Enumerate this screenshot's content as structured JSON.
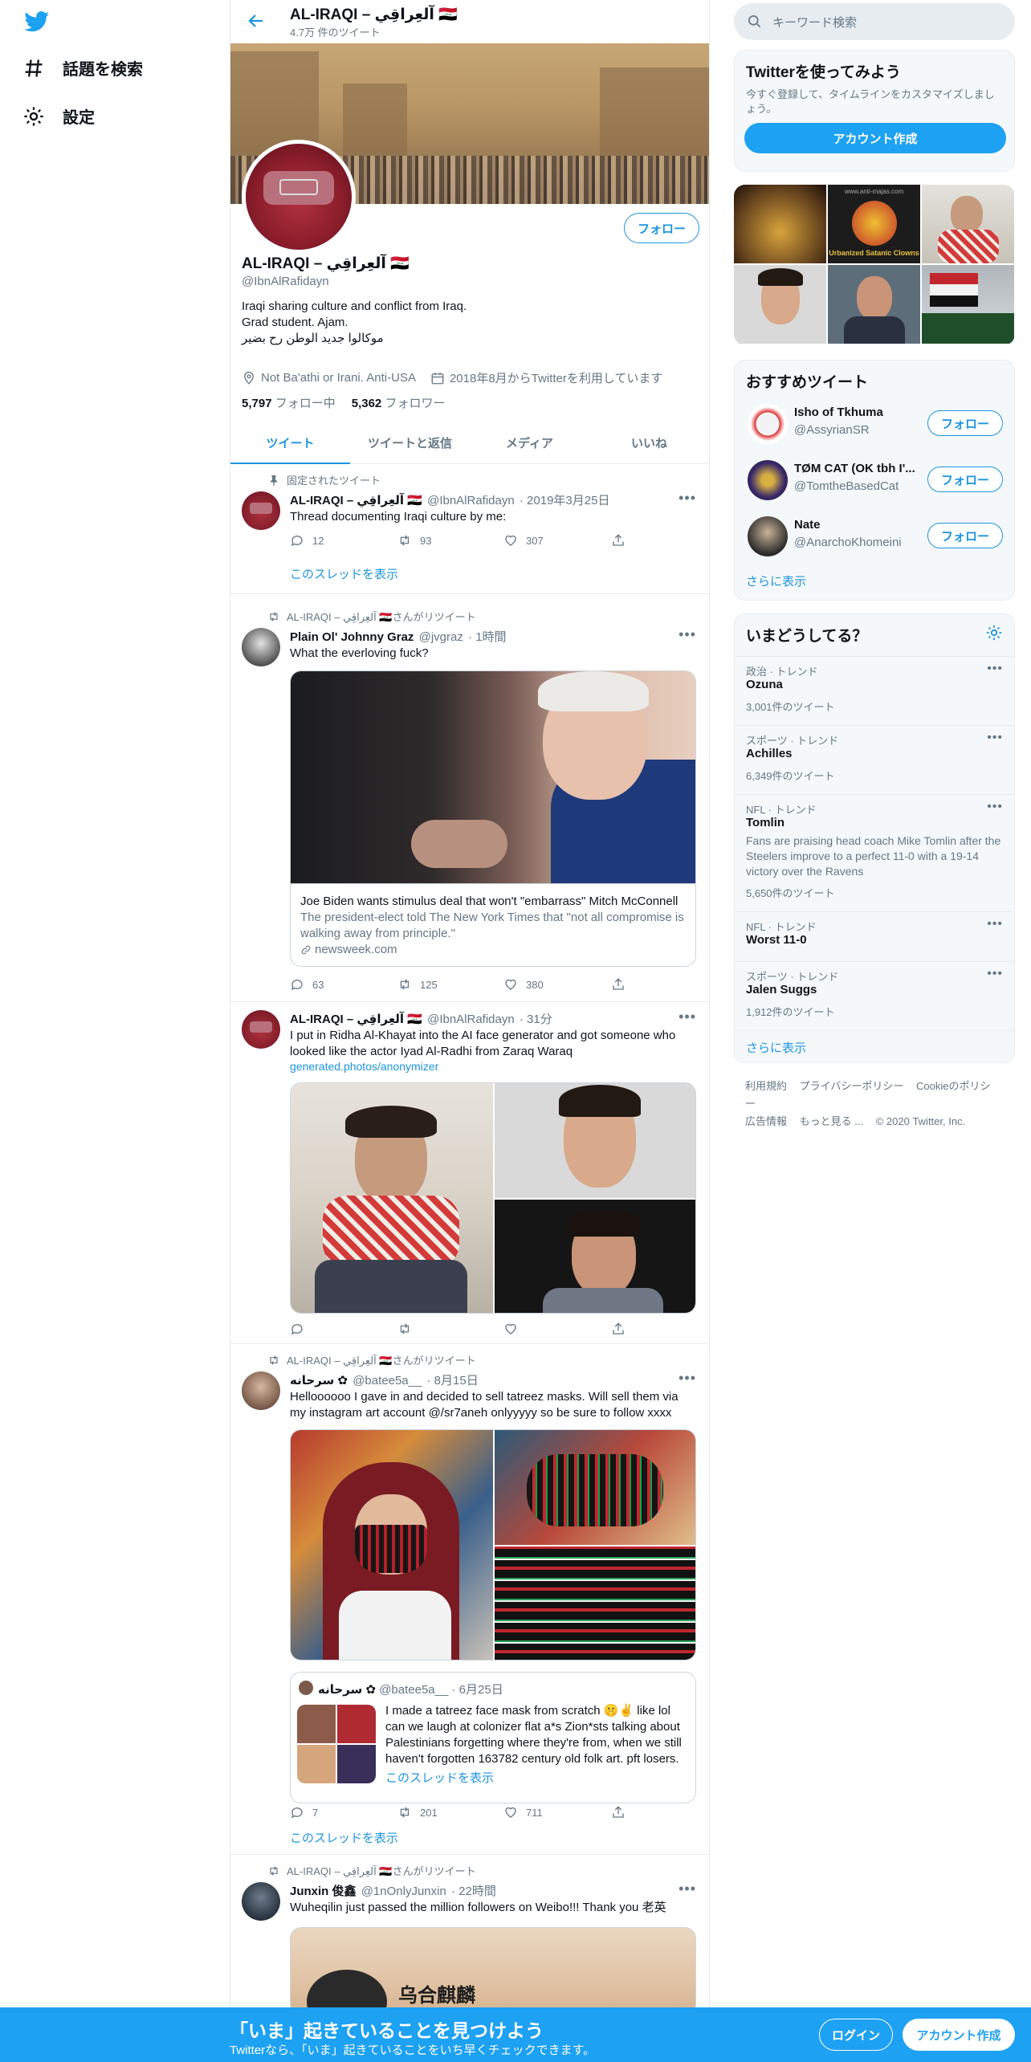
{
  "nav": {
    "explore_label": "話題を検索",
    "settings_label": "設定"
  },
  "header": {
    "name": "AL-IRAQI – آلعِراقِي 🇮🇶",
    "tweet_count": "4.7万 件のツイート"
  },
  "profile": {
    "name": "AL-IRAQI – آلعِراقِي 🇮🇶",
    "handle": "@IbnAlRafidayn",
    "follow_label": "フォロー",
    "bio_line1": "Iraqi sharing culture and conflict from Iraq.",
    "bio_line2": "Grad student. Ajam.",
    "bio_line3": "موﻛﺎﻟﻮا ﺟﺪﻳﺪ اﻟﻮﻃﻦ رح ﺑﻀﻴﺮ",
    "location": "Not Ba'athi or Irani. Anti-USA",
    "joined": "2018年8月からTwitterを利用しています",
    "following_count": "5,797",
    "following_label": "フォロー中",
    "followers_count": "5,362",
    "followers_label": "フォロワー"
  },
  "tabs": [
    "ツイート",
    "ツイートと返信",
    "メディア",
    "いいね"
  ],
  "tweets": [
    {
      "context": "固定されたツイート",
      "name": "AL-IRAQI – آلعِراقِي 🇮🇶",
      "handle": "@IbnAlRafidayn",
      "time": "· 2019年3月25日",
      "text": "Thread documenting Iraqi culture by me:",
      "replies": "12",
      "retweets": "93",
      "likes": "307",
      "thread_link": "このスレッドを表示"
    },
    {
      "context": "AL-IRAQI – آلعِراقِي 🇮🇶さんがリツイート",
      "name": "Plain Ol' Johnny Graz",
      "handle": "@jvgraz",
      "time": "· 1時間",
      "text": "What the everloving fuck?",
      "card_title": "Joe Biden wants stimulus deal that won't \"embarrass\" Mitch McConnell",
      "card_desc": "The president-elect told The New York Times that \"not all compromise is walking away from principle.\"",
      "card_domain": "newsweek.com",
      "replies": "63",
      "retweets": "125",
      "likes": "380"
    },
    {
      "name": "AL-IRAQI – آلعِراقِي 🇮🇶",
      "handle": "@IbnAlRafidayn",
      "time": "· 31分",
      "text": "I put in Ridha Al-Khayat into the AI face generator and got someone who looked like the actor Iyad Al-Radhi from Zaraq Waraq",
      "link": "generated.photos/anonymizer"
    },
    {
      "context": "AL-IRAQI – آلعِراقِي 🇮🇶さんがリツイート",
      "name": "سرحانه ✿",
      "handle": "@batee5a__",
      "time": "· 8月15日",
      "text": "Helloooooo I gave in and decided to sell tatreez masks. Will sell them via my instagram art account @/sr7aneh onlyyyyy so be sure to follow xxxx",
      "quote_name": "سرحانه ✿",
      "quote_handle": "@batee5a__",
      "quote_time": "· 6月25日",
      "quote_text": "I made a tatreez face mask from scratch 🤫✌️ like lol can we laugh at colonizer flat a*s Zion*sts talking about Palestinians forgetting where they're from, when we still haven't forgotten 163782 century old folk art. pft losers.",
      "quote_thread": "このスレッドを表示",
      "replies": "7",
      "retweets": "201",
      "likes": "711",
      "thread_link": "このスレッドを表示"
    },
    {
      "context": "AL-IRAQI – آلعِراقِي 🇮🇶さんがリツイート",
      "name": "Junxin 俊鑫",
      "handle": "@1nOnlyJunxin",
      "time": "· 22時間",
      "text": "Wuheqilin just passed the million followers on Weibo!!! Thank you 老英",
      "image_text": "乌合麒麟"
    }
  ],
  "right": {
    "search_placeholder": "キーワード検索",
    "signup_title": "Twitterを使ってみよう",
    "signup_desc": "今すぐ登録して、タイムラインをカスタマイズしましょう。",
    "signup_button": "アカウント作成",
    "photo_caption": "Urbanized Satanic Clowns",
    "photo_url": "www.anti-majas.com",
    "rec_title": "おすすめツイート",
    "recommendations": [
      {
        "name": "Isho of Tkhuma",
        "handle": "@AssyrianSR",
        "button": "フォロー"
      },
      {
        "name": "TØM CAT (OK tbh I'...",
        "handle": "@TomtheBasedCat",
        "button": "フォロー"
      },
      {
        "name": "Nate",
        "handle": "@AnarchoKhomeini",
        "button": "フォロー"
      }
    ],
    "rec_more": "さらに表示",
    "trends_title": "いまどうしてる？",
    "trends": [
      {
        "category": "政治 · トレンド",
        "name": "Ozuna",
        "count": "3,001件のツイート"
      },
      {
        "category": "スポーツ · トレンド",
        "name": "Achilles",
        "count": "6,349件のツイート"
      },
      {
        "category": "NFL · トレンド",
        "name": "Tomlin",
        "desc": "Fans are praising head coach Mike Tomlin after the Steelers improve to a perfect 11-0 with a 19-14 victory over the Ravens",
        "count": "5,650件のツイート"
      },
      {
        "category": "NFL · トレンド",
        "name": "Worst 11-0"
      },
      {
        "category": "スポーツ · トレンド",
        "name": "Jalen Suggs",
        "count": "1,912件のツイート"
      }
    ],
    "trends_more": "さらに表示",
    "footer": {
      "terms": "利用規約",
      "privacy": "プライバシーポリシー",
      "cookie": "Cookieのポリシー",
      "ads": "広告情報",
      "more": "もっと見る ...",
      "copyright": "© 2020 Twitter, Inc."
    }
  },
  "bottombar": {
    "title": "「いま」起きていることを見つけよう",
    "subtitle": "Twitterなら、「いま」起きていることをいち早くチェックできます。",
    "login": "ログイン",
    "signup": "アカウント作成"
  },
  "colors": {
    "accent": "#1da1f2",
    "link": "#1b95e0",
    "secondary_text": "#657786"
  }
}
